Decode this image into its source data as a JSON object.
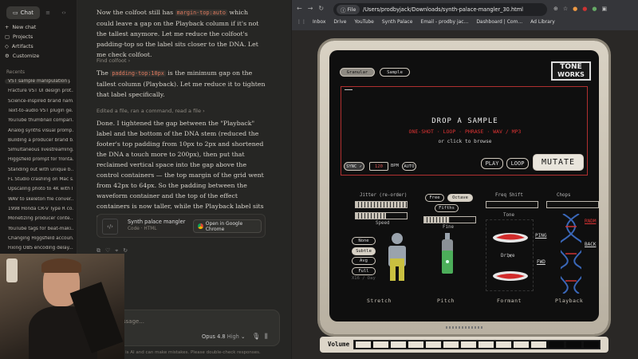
{
  "sidebar": {
    "tabs": [
      "Chat"
    ],
    "actions": [
      "New chat",
      "Projects",
      "Artifacts",
      "Customize"
    ],
    "recents_label": "Recents",
    "recents": [
      "VST sample manipulation pl...",
      "Fracture VST UI design prot...",
      "Science-inspired brand nam...",
      "Text-to-audio VST plugin ge...",
      "YouTube thumbnail compari...",
      "Analog synths visual promp...",
      "Building a producer brand b...",
      "Simultaneous livestreaming...",
      "Higgsfield prompt for fronta...",
      "Standing out with unique b...",
      "FL Studio crashing on Mac s...",
      "Upscaling photo to 4K with I...",
      "WAV to skeleton file conver...",
      "1998 Honda CR-V Type R co...",
      "Monetizing producer conte...",
      "YouTube tags for beat-maki...",
      "Changing Higgsfield accoun...",
      "Fixing OBS encoding delay..."
    ]
  },
  "chat": {
    "p1_a": "Now the colfoot still has ",
    "p1_code": "margin-top:auto",
    "p1_b": " which could leave a gap on the Playback column if it's not the tallest anymore. Let me reduce the colfoot's padding-top so the label sits closer to the DNA. Let me check colfoot.",
    "find": "Find colfoot",
    "p2_a": "The ",
    "p2_code": "padding-top:10px",
    "p2_b": " is the minimum gap on the tallest column (Playback). Let me reduce it to tighten that label specifically.",
    "edited": "Edited a file, ran a command, read a file",
    "p3": "Done. I tightened the gap between the \"Playback\" label and the bottom of the DNA stem (reduced the footer's top padding from 10px to 2px and shortened the DNA a touch more to 200px), then put that reclaimed vertical space into the gap above the control containers — the top margin of the grid went from 42px to 64px. So the padding between the waveform container and the top of the effect containers is now taller, while the Playback label sits closer under its DNA stem.",
    "artifact_title": "Synth palace mangler",
    "artifact_sub": "Code · HTML",
    "open_btn": "Open in Google Chrome",
    "input_placeholder": "ssage...",
    "model": "Opus 4.8",
    "effort": "High",
    "disclaimer": "e is AI and can make mistakes. Please double-check responses."
  },
  "browser": {
    "scheme_label": "File",
    "url": "/Users/prodbyjack/Downloads/synth-palace-mangler_30.html",
    "bookmarks": [
      "Inbox",
      "Drive",
      "YouTube",
      "Synth Palace",
      "Email - prodby jac...",
      "Dashboard | Com...",
      "Ad Library"
    ]
  },
  "plugin": {
    "tabs": [
      "Granular",
      "Sample"
    ],
    "logo_line1": "TONE",
    "logo_line2": "WORKS",
    "drop_title": "DROP A SAMPLE",
    "drop_types": "ONE-SHOT · LOOP · PHRASE · WAV / MP3",
    "drop_hint": "or click to browse",
    "sync": "SYNC ✓",
    "bpm_value": "120",
    "bpm_label": "BPM",
    "auto": "AUTO",
    "play": "PLAY",
    "loop": "LOOP",
    "mutate": "MUTATE",
    "jitter_label": "Jitter (re-order)",
    "speed_label": "Speed",
    "speed_options": [
      "None",
      "Subtle",
      "Avg",
      "Full"
    ],
    "speed_selected": "Subtle",
    "speed_range": "X16 / Day",
    "pitch_buttons": [
      "Free",
      "Octave",
      "Fifths"
    ],
    "pitch_selected": "Octave",
    "fine_label": "Fine",
    "freq_label": "Freq Shift",
    "tone_label": "Tone",
    "drive_label": "Drive",
    "chops_label": "Chops",
    "random": "RNDM",
    "pong": "PING",
    "back": "BACK",
    "fwd": "FWD",
    "col_labels": [
      "Stretch",
      "Pitch",
      "Formant",
      "Playback"
    ],
    "volume_label": "Volume",
    "volume_level": 0.82
  }
}
